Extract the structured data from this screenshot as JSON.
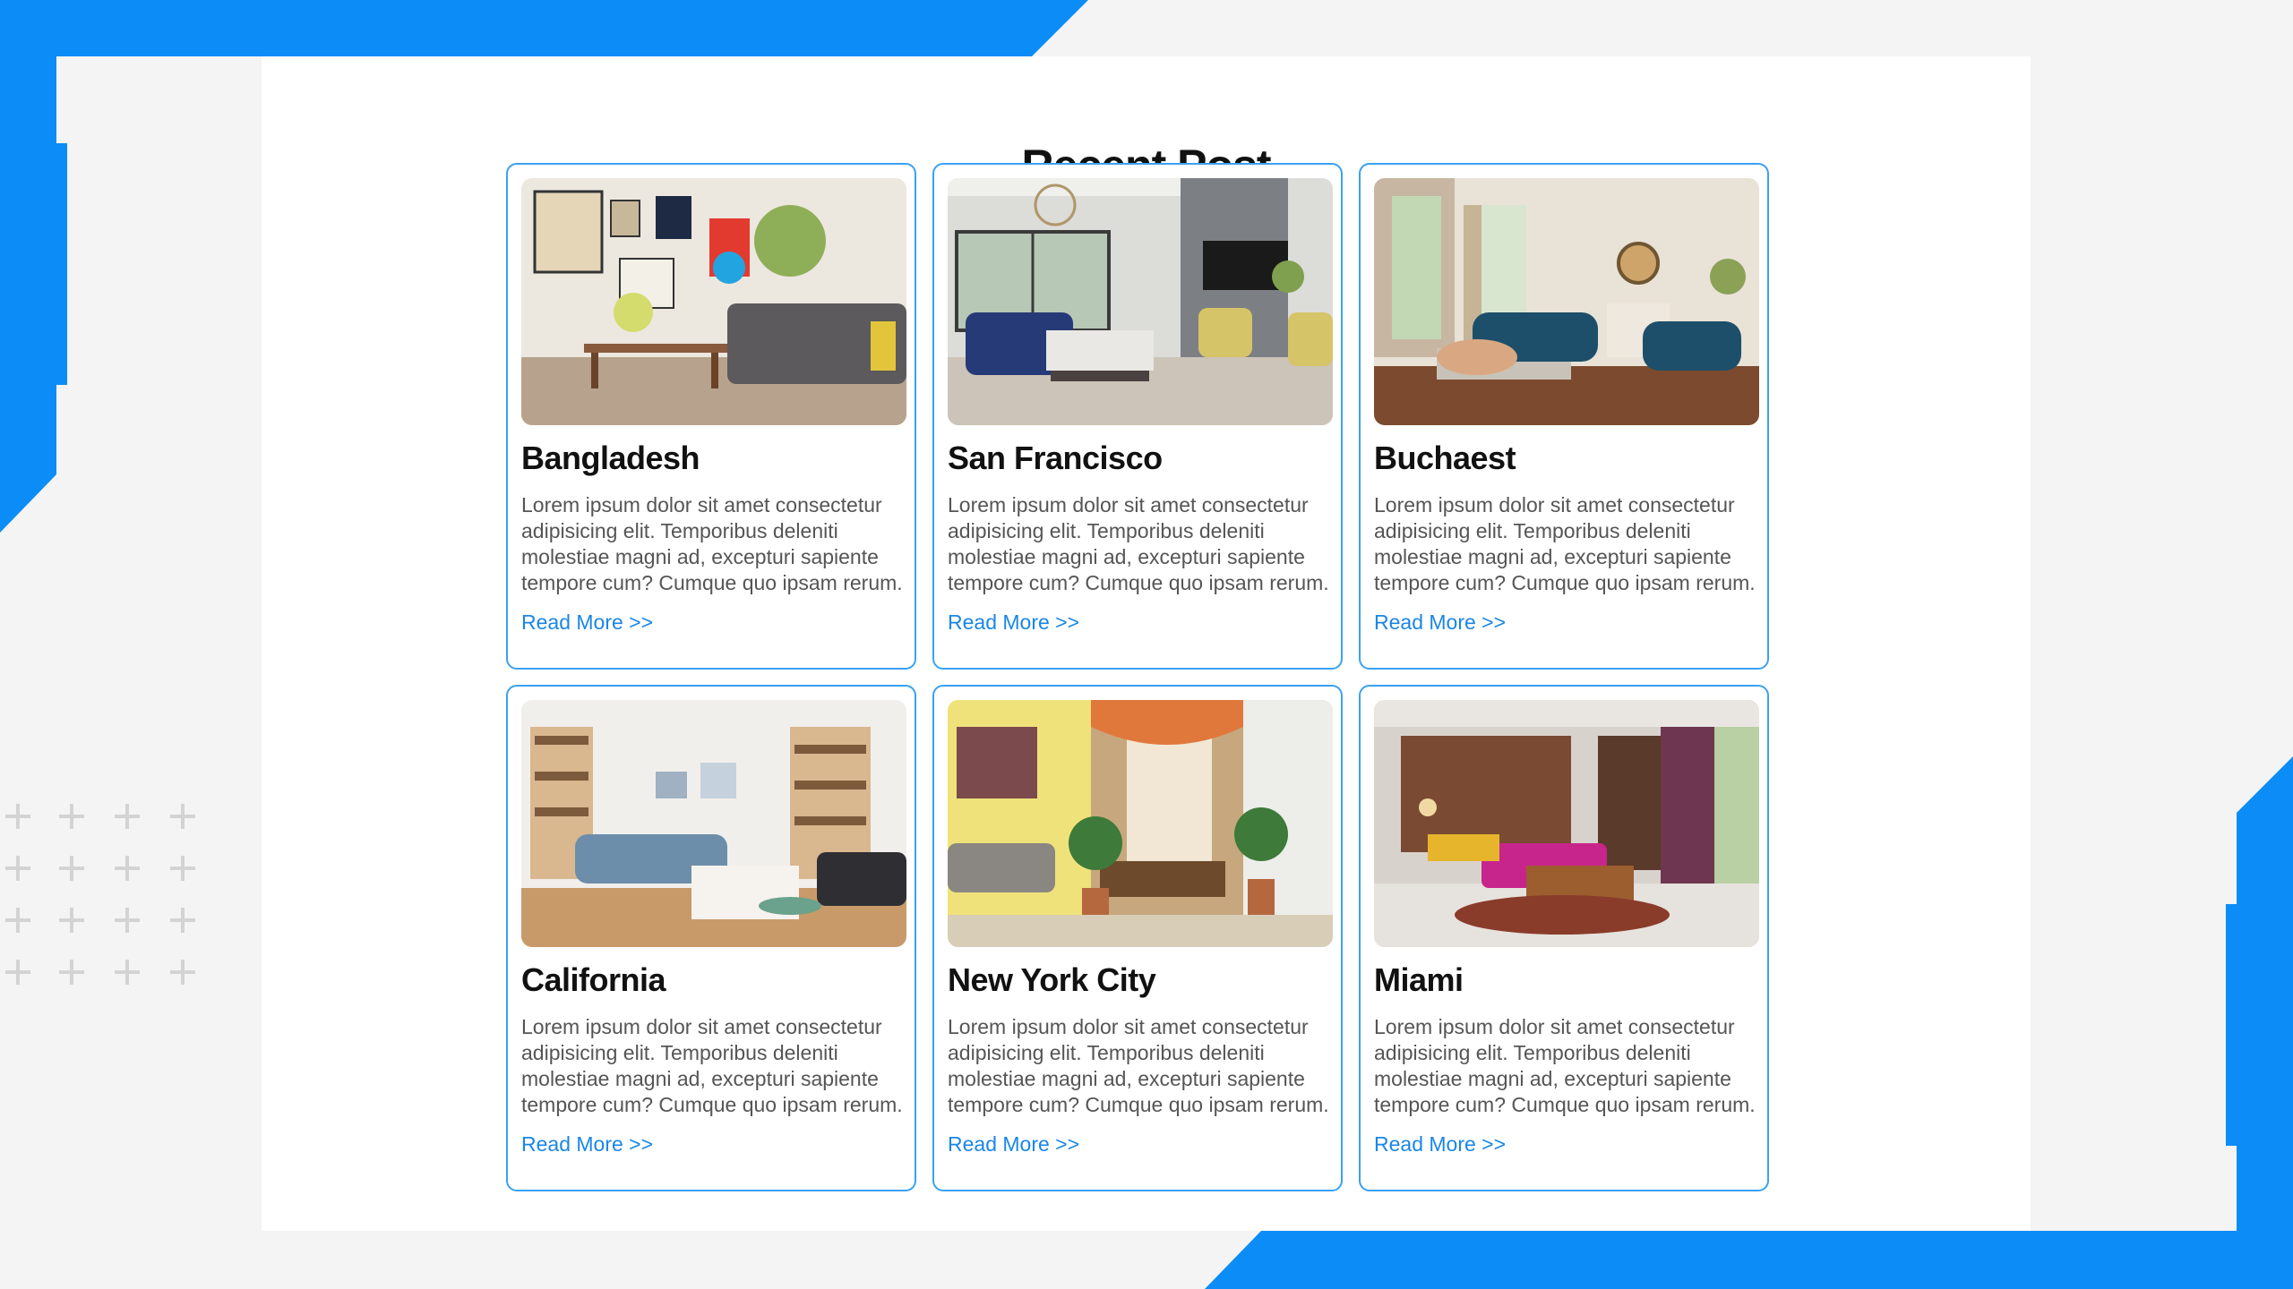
{
  "section": {
    "title": "Recent Post"
  },
  "posts": [
    {
      "title": "Bangladesh",
      "excerpt": "Lorem ipsum dolor sit amet consectetur adipisicing elit. Temporibus deleniti molestiae magni ad, excepturi sapiente tempore cum? Cumque quo ipsam rerum.",
      "link": "Read More >>"
    },
    {
      "title": "San Francisco",
      "excerpt": "Lorem ipsum dolor sit amet consectetur adipisicing elit. Temporibus deleniti molestiae magni ad, excepturi sapiente tempore cum? Cumque quo ipsam rerum.",
      "link": "Read More >>"
    },
    {
      "title": "Buchaest",
      "excerpt": "Lorem ipsum dolor sit amet consectetur adipisicing elit. Temporibus deleniti molestiae magni ad, excepturi sapiente tempore cum? Cumque quo ipsam rerum.",
      "link": "Read More >>"
    },
    {
      "title": "California",
      "excerpt": "Lorem ipsum dolor sit amet consectetur adipisicing elit. Temporibus deleniti molestiae magni ad, excepturi sapiente tempore cum? Cumque quo ipsam rerum.",
      "link": "Read More >>"
    },
    {
      "title": "New York City",
      "excerpt": "Lorem ipsum dolor sit amet consectetur adipisicing elit. Temporibus deleniti molestiae magni ad, excepturi sapiente tempore cum? Cumque quo ipsam rerum.",
      "link": "Read More >>"
    },
    {
      "title": "Miami",
      "excerpt": "Lorem ipsum dolor sit amet consectetur adipisicing elit. Temporibus deleniti molestiae magni ad, excepturi sapiente tempore cum? Cumque quo ipsam rerum.",
      "link": "Read More >>"
    }
  ],
  "colors": {
    "accent": "#0c8cf6",
    "card_border": "#3aa1f4",
    "link": "#1a86e6",
    "title_text": "#111111",
    "body_text": "#555555"
  }
}
